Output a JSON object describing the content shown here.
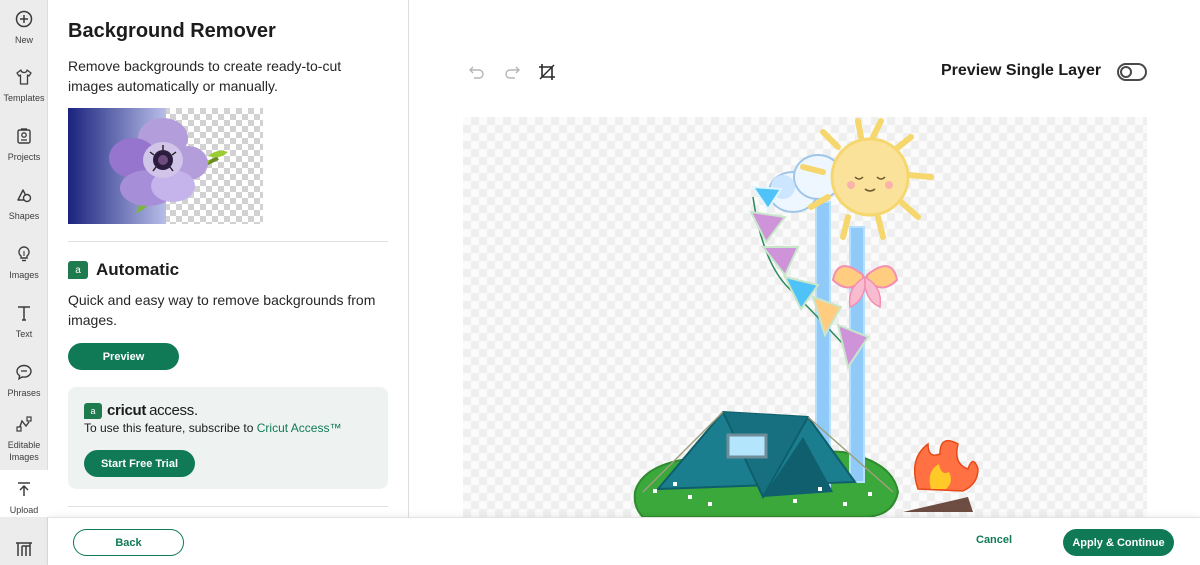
{
  "rail": {
    "items": [
      {
        "label": "New",
        "icon": "plus-circle-icon"
      },
      {
        "label": "Templates",
        "icon": "shirt-icon"
      },
      {
        "label": "Projects",
        "icon": "projects-icon"
      },
      {
        "label": "Shapes",
        "icon": "shapes-icon"
      },
      {
        "label": "Images",
        "icon": "lightbulb-icon"
      },
      {
        "label": "Text",
        "icon": "text-icon"
      },
      {
        "label": "Phrases",
        "icon": "speech-bubble-icon"
      },
      {
        "label": "Editable\nImages",
        "icon": "editable-images-icon"
      },
      {
        "label": "Upload",
        "icon": "upload-icon"
      },
      {
        "label": "",
        "icon": "monogram-icon"
      }
    ]
  },
  "panel": {
    "title": "Background Remover",
    "intro": "Remove backgrounds to create ready-to-cut images automatically or manually.",
    "automatic": {
      "heading": "Automatic",
      "badge": "a",
      "description": "Quick and easy way to remove backgrounds from images.",
      "preview_label": "Preview"
    },
    "access": {
      "brand": "cricut",
      "brand_suffix": "access.",
      "text_prefix": "To use this feature, subscribe to ",
      "link": "Cricut Access™",
      "trial_label": "Start Free Trial"
    }
  },
  "canvas": {
    "preview_single_layer_label": "Preview Single Layer",
    "preview_single_layer_on": false,
    "toolbar": [
      "undo-icon",
      "redo-icon",
      "crop-icon"
    ]
  },
  "footer": {
    "back_label": "Back",
    "cancel_label": "Cancel",
    "apply_label": "Apply & Continue"
  },
  "colors": {
    "accent": "#0f7a55",
    "rail_bg": "#ececec"
  }
}
